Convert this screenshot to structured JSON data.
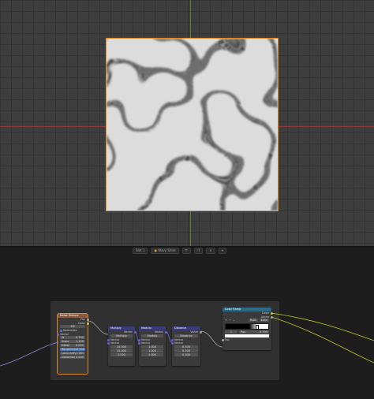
{
  "colors": {
    "texture_node": "#8a5a3c",
    "vector_node": "#3a3c7a",
    "converter_node": "#2f6b86",
    "selected": "#e08a24"
  },
  "viewport": {
    "name": "3d-viewport",
    "texture_desc": "wave pattern preview"
  },
  "header": {
    "slot": "Slot 1",
    "material": "Wavy Shire",
    "icons": [
      "shield-icon",
      "copy-icon",
      "close-icon",
      "pin-icon"
    ]
  },
  "nodes": {
    "noise": {
      "title": "Noise Texture",
      "outputs": [
        "Fac",
        "Color"
      ],
      "mode": "4D",
      "normalize": "Normalize",
      "input_vector": "Vector",
      "fields": [
        {
          "label": "W",
          "value": "0.700"
        },
        {
          "label": "Scale",
          "value": "1.100"
        },
        {
          "label": "Detail",
          "value": "0.000"
        },
        {
          "label": "Roughness",
          "value": "0.500"
        },
        {
          "label": "Lacunarity",
          "value": "2.000"
        },
        {
          "label": "Distortion",
          "value": "0.000"
        }
      ]
    },
    "multiply": {
      "title": "Multiply",
      "output": "Vector",
      "operation": "Multiply",
      "in1": "Vector",
      "in2": "Vector",
      "values": [
        "15.000",
        "15.000",
        "2.000"
      ]
    },
    "modulo": {
      "title": "Modulo",
      "output": "Vector",
      "operation": "Modulo",
      "in1": "Vector",
      "in2": "Vector",
      "values": [
        "1.000",
        "1.000",
        "1.000"
      ]
    },
    "distance": {
      "title": "Distance",
      "output": "Value",
      "operation": "Distance",
      "in1": "Vector",
      "in2": "Vector",
      "values": [
        "0.500",
        "0.500",
        "0.500"
      ]
    },
    "ramp": {
      "title": "Color Ramp",
      "outputs": [
        "Color",
        "Alpha"
      ],
      "color_mode": "RGB",
      "interpolation": "Ease",
      "stop_index": "1",
      "stop_pos_label": "Pos",
      "stop_pos": "0.700",
      "input": "Fac"
    }
  }
}
